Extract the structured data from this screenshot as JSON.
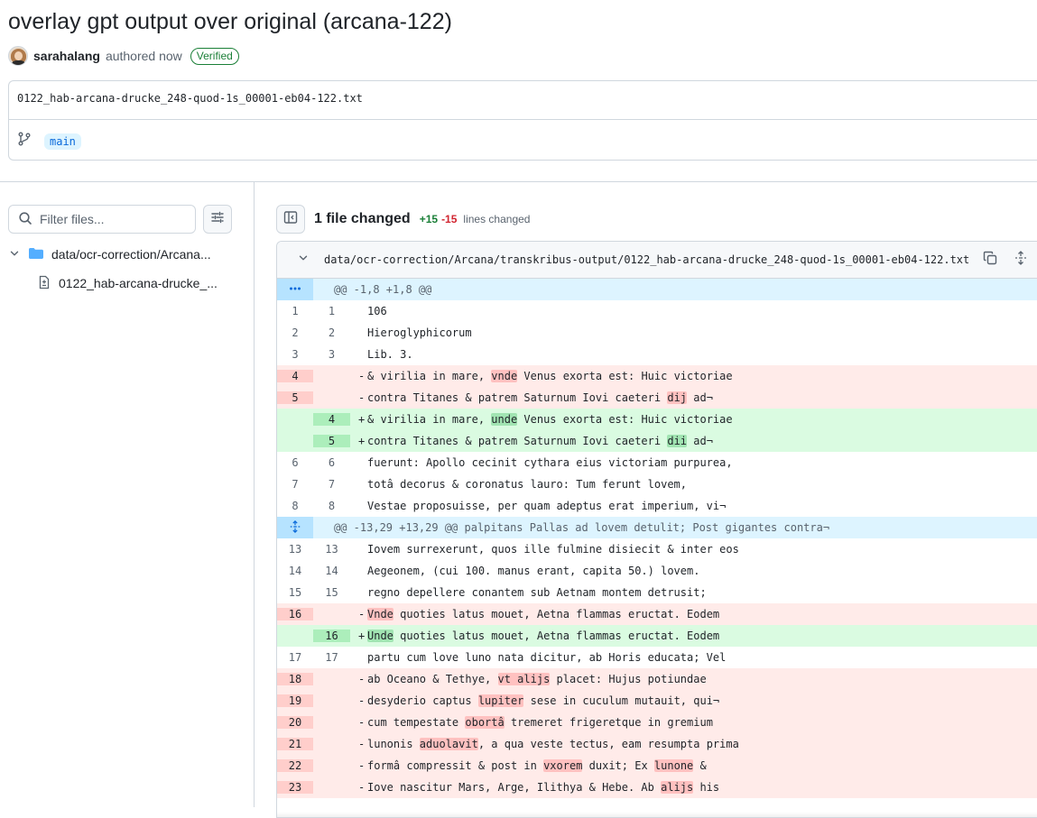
{
  "commit": {
    "title": "overlay gpt output over original (arcana-122)",
    "author": "sarahalang",
    "authored_text": "authored now",
    "verified_label": "Verified",
    "message": "0122_hab-arcana-drucke_248-quod-1s_00001-eb04-122.txt",
    "branch": "main"
  },
  "sidebar": {
    "filter_placeholder": "Filter files...",
    "folder": "data/ocr-correction/Arcana...",
    "file": "0122_hab-arcana-drucke_..."
  },
  "summary": {
    "files_changed": "1 file changed",
    "additions": "+15",
    "deletions": "-15",
    "lines_changed": "lines changed"
  },
  "file": {
    "path": "data/ocr-correction/Arcana/transkribus-output/0122_hab-arcana-drucke_248-quod-1s_00001-eb04-122.txt"
  },
  "colors": {
    "addition": "#1a7f37",
    "deletion": "#d1242f",
    "link": "#0969da",
    "hunk_bg": "#ddf4ff",
    "del_bg": "#ffebe9",
    "add_bg": "#dafbe1"
  },
  "diff": [
    {
      "type": "hunk",
      "text": "@@ -1,8 +1,8 @@",
      "icon": "ellipsis-icon"
    },
    {
      "type": "ctx",
      "old": "1",
      "new": "1",
      "segs": [
        {
          "t": "106"
        }
      ]
    },
    {
      "type": "ctx",
      "old": "2",
      "new": "2",
      "segs": [
        {
          "t": "Hieroglyphicorum"
        }
      ]
    },
    {
      "type": "ctx",
      "old": "3",
      "new": "3",
      "segs": [
        {
          "t": "Lib. 3."
        }
      ]
    },
    {
      "type": "del",
      "old": "4",
      "new": "",
      "segs": [
        {
          "t": "& virilia in mare, "
        },
        {
          "t": "vnde",
          "h": true
        },
        {
          "t": " Venus exorta est: Huic victoriae"
        }
      ]
    },
    {
      "type": "del",
      "old": "5",
      "new": "",
      "segs": [
        {
          "t": "contra Titanes & patrem Saturnum Iovi caeteri "
        },
        {
          "t": "dij",
          "h": true
        },
        {
          "t": " ad¬"
        }
      ]
    },
    {
      "type": "add",
      "old": "",
      "new": "4",
      "segs": [
        {
          "t": "& virilia in mare, "
        },
        {
          "t": "unde",
          "h": true
        },
        {
          "t": " Venus exorta est: Huic victoriae"
        }
      ]
    },
    {
      "type": "add",
      "old": "",
      "new": "5",
      "segs": [
        {
          "t": "contra Titanes & patrem Saturnum Iovi caeteri "
        },
        {
          "t": "dii",
          "h": true
        },
        {
          "t": " ad¬"
        }
      ]
    },
    {
      "type": "ctx",
      "old": "6",
      "new": "6",
      "segs": [
        {
          "t": "fuerunt: Apollo cecinit cythara eius victoriam purpurea,"
        }
      ]
    },
    {
      "type": "ctx",
      "old": "7",
      "new": "7",
      "segs": [
        {
          "t": "totâ decorus & coronatus lauro: Tum ferunt lovem,"
        }
      ]
    },
    {
      "type": "ctx",
      "old": "8",
      "new": "8",
      "segs": [
        {
          "t": "Vestae proposuisse, per quam adeptus erat imperium, vi¬"
        }
      ]
    },
    {
      "type": "hunk",
      "text": "@@ -13,29 +13,29 @@ palpitans Pallas ad lovem detulit; Post gigantes contra¬",
      "icon": "unfold-icon"
    },
    {
      "type": "ctx",
      "old": "13",
      "new": "13",
      "segs": [
        {
          "t": "Iovem surrexerunt, quos ille fulmine disiecit & inter eos"
        }
      ]
    },
    {
      "type": "ctx",
      "old": "14",
      "new": "14",
      "segs": [
        {
          "t": "Aegeonem, (cui 100. manus erant, capita 50.) lovem."
        }
      ]
    },
    {
      "type": "ctx",
      "old": "15",
      "new": "15",
      "segs": [
        {
          "t": "regno depellere conantem sub Aetnam montem detrusit;"
        }
      ]
    },
    {
      "type": "del",
      "old": "16",
      "new": "",
      "segs": [
        {
          "t": "Vnde",
          "h": true
        },
        {
          "t": " quoties latus mouet, Aetna flammas eructat. Eodem"
        }
      ]
    },
    {
      "type": "add",
      "old": "",
      "new": "16",
      "segs": [
        {
          "t": "Unde",
          "h": true
        },
        {
          "t": " quoties latus mouet, Aetna flammas eructat. Eodem"
        }
      ]
    },
    {
      "type": "ctx",
      "old": "17",
      "new": "17",
      "segs": [
        {
          "t": "partu cum love luno nata dicitur, ab Horis educata; Vel"
        }
      ]
    },
    {
      "type": "del",
      "old": "18",
      "new": "",
      "segs": [
        {
          "t": "ab Oceano & Tethye, "
        },
        {
          "t": "vt alijs",
          "h": true
        },
        {
          "t": " placet: Hujus potiundae"
        }
      ]
    },
    {
      "type": "del",
      "old": "19",
      "new": "",
      "segs": [
        {
          "t": "desyderio captus "
        },
        {
          "t": "lupiter",
          "h": true
        },
        {
          "t": " sese in cuculum mutauit, qui¬"
        }
      ]
    },
    {
      "type": "del",
      "old": "20",
      "new": "",
      "segs": [
        {
          "t": "cum tempestate "
        },
        {
          "t": "obortâ",
          "h": true
        },
        {
          "t": " tremeret frigeretque in gremium"
        }
      ]
    },
    {
      "type": "del",
      "old": "21",
      "new": "",
      "segs": [
        {
          "t": "lunonis "
        },
        {
          "t": "aduolavit",
          "h": true
        },
        {
          "t": ", a qua veste tectus, eam resumpta prima"
        }
      ]
    },
    {
      "type": "del",
      "old": "22",
      "new": "",
      "segs": [
        {
          "t": "formâ compressit & post in "
        },
        {
          "t": "vxorem",
          "h": true
        },
        {
          "t": " duxit; Ex "
        },
        {
          "t": "lunone",
          "h": true
        },
        {
          "t": " &"
        }
      ]
    },
    {
      "type": "del",
      "old": "23",
      "new": "",
      "segs": [
        {
          "t": "Iove nascitur Mars, Arge, Ilithya & Hebe. Ab "
        },
        {
          "t": "alijs",
          "h": true
        },
        {
          "t": " his"
        }
      ]
    }
  ]
}
